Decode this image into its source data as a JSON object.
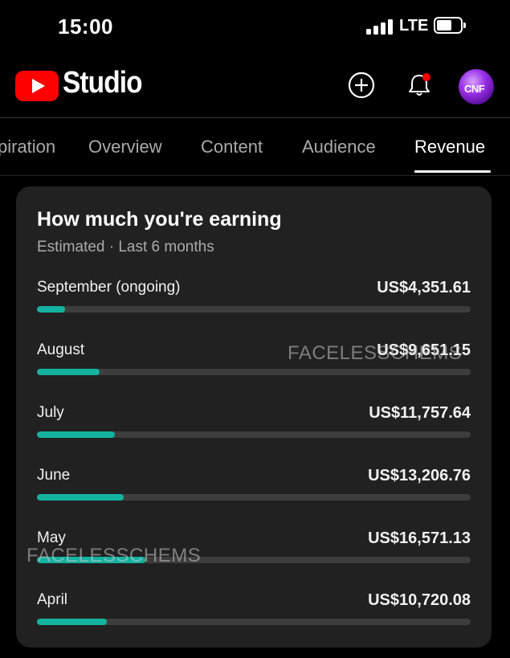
{
  "status_bar": {
    "time": "15:00",
    "network": "LTE",
    "signal_bars": 4,
    "battery_level": 0.65
  },
  "header": {
    "app_name": "Studio",
    "logo_color": "#ff0000",
    "icons": [
      "create-icon",
      "notifications-icon"
    ],
    "notification_dot_color": "#ff0000",
    "avatar_text": "CNF"
  },
  "tabs": [
    {
      "label": "piration",
      "active": false
    },
    {
      "label": "Overview",
      "active": false
    },
    {
      "label": "Content",
      "active": false
    },
    {
      "label": "Audience",
      "active": false
    },
    {
      "label": "Revenue",
      "active": true
    }
  ],
  "card": {
    "title": "How much you're earning",
    "subtitle": "Estimated · Last 6 months",
    "bar_color": "#13b3a0",
    "rows": [
      {
        "month": "September (ongoing)",
        "amount": "US$4,351.61",
        "progress": 0.065
      },
      {
        "month": "August",
        "amount": "US$9,651.15",
        "progress": 0.145
      },
      {
        "month": "July",
        "amount": "US$11,757.64",
        "progress": 0.18
      },
      {
        "month": "June",
        "amount": "US$13,206.76",
        "progress": 0.2
      },
      {
        "month": "May",
        "amount": "US$16,571.13",
        "progress": 0.25
      },
      {
        "month": "April",
        "amount": "US$10,720.08",
        "progress": 0.162
      }
    ]
  },
  "watermarks": [
    "FACELESSCHEMS",
    "FACELESSCHEMS"
  ]
}
